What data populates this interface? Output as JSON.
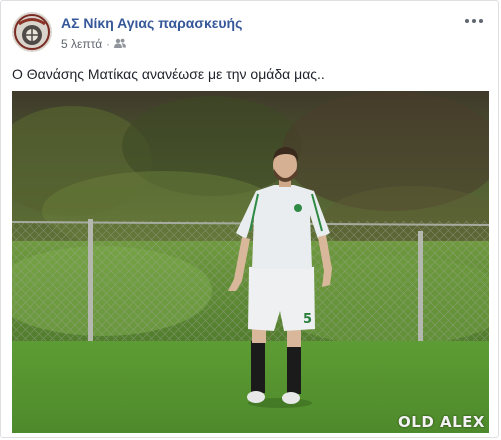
{
  "post": {
    "author": "ΑΣ Νίκη Αγιας παρασκευής",
    "time": "5 λεπτά",
    "separator": "·",
    "audience_icon": "friends-icon",
    "menu_icon": "more-options-icon",
    "caption": "Ο Θανάσης Ματίκας ανανέωσε με την ομάδα μας..",
    "photo": {
      "subject": "soccer player in white kit with number 5 walking on grass field",
      "jersey_number": "5",
      "watermark": "OLD ALEX"
    }
  },
  "colors": {
    "author": "#365899",
    "meta": "#616770",
    "text": "#1d2129",
    "border": "#dddfe2"
  }
}
